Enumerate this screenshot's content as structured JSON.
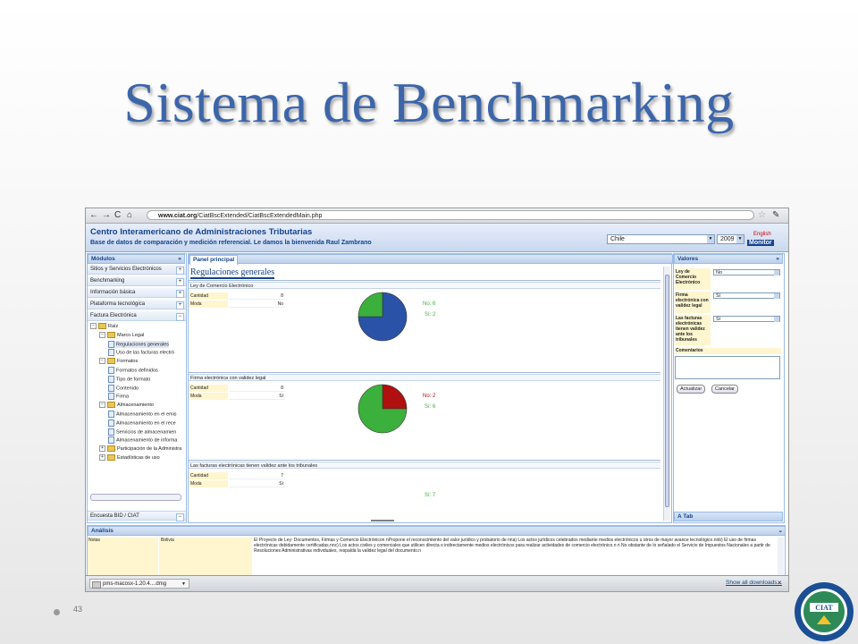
{
  "slide": {
    "title": "Sistema de Benchmarking",
    "page_number": "43",
    "seal_text": "CIAT"
  },
  "browser": {
    "url_host": "www.ciat.org",
    "url_path": "/CiatBscExtended/CiatBscExtendedMain.php",
    "back": "←",
    "forward": "→",
    "reload": "C",
    "home": "⌂"
  },
  "app": {
    "org_name": "Centro Interamericano de Administraciones Tributarias",
    "welcome": "Base de datos de comparación y medición referencial. Le damos la bienvenida Raul Zambrano",
    "country": "Chile",
    "year": "2009",
    "language": "English",
    "monitor": "Monitor"
  },
  "modules": {
    "header": "Módulos",
    "items": [
      {
        "label": "Sitios y Servicios Electrónicos",
        "toggle": "+"
      },
      {
        "label": "Benchmarking",
        "toggle": "+"
      },
      {
        "label": "Información básica",
        "toggle": "+"
      },
      {
        "label": "Plataforma tecnológica",
        "toggle": "+"
      },
      {
        "label": "Factura Electrónica",
        "toggle": "−"
      }
    ],
    "tree": [
      {
        "label": "Raíz",
        "type": "folder",
        "level": 0
      },
      {
        "label": "Marco Legal",
        "type": "folder",
        "level": 1
      },
      {
        "label": "Regulaciones generales",
        "type": "doc",
        "level": 2,
        "selected": true
      },
      {
        "label": "Uso de las facturas electró",
        "type": "doc",
        "level": 2
      },
      {
        "label": "Formatos",
        "type": "folder",
        "level": 1
      },
      {
        "label": "Formatos definidos",
        "type": "doc",
        "level": 2
      },
      {
        "label": "Tipo de formato",
        "type": "doc",
        "level": 2
      },
      {
        "label": "Contenido",
        "type": "doc",
        "level": 2
      },
      {
        "label": "Firma",
        "type": "doc",
        "level": 2
      },
      {
        "label": "Almacenamiento",
        "type": "folder",
        "level": 1
      },
      {
        "label": "Almacenamiento en el emis",
        "type": "doc",
        "level": 2
      },
      {
        "label": "Almacenamiento en el rece",
        "type": "doc",
        "level": 2
      },
      {
        "label": "Servicios de almacenamien",
        "type": "doc",
        "level": 2
      },
      {
        "label": "Almacenamiento de informa",
        "type": "doc",
        "level": 2
      },
      {
        "label": "Participación de la Administra",
        "type": "folder",
        "level": 1
      },
      {
        "label": "Estadísticas de uso",
        "type": "folder",
        "level": 1
      }
    ],
    "footer": "Encuesta BID / CIAT"
  },
  "main": {
    "tab": "Panel principal",
    "section_title": "Regulaciones generales",
    "cantidad_label": "Cantidad",
    "moda_label": "Moda",
    "blocks": [
      {
        "title": "Ley de Comercio Electrónico",
        "cantidad": "8",
        "moda": "No",
        "no_label": "No: 6",
        "si_label": "Sí: 2",
        "no": 6,
        "si": 2
      },
      {
        "title": "Firma electrónica con validez legal",
        "cantidad": "8",
        "moda": "Sí",
        "no_label": "No: 2",
        "si_label": "Sí: 6",
        "no": 2,
        "si": 6
      },
      {
        "title": "Las facturas electrónicas tienen validez ante los tribunales",
        "cantidad": "7",
        "moda": "Sí",
        "no_label": "",
        "si_label": "Sí: 7",
        "no": 0,
        "si": 7
      }
    ]
  },
  "values_panel": {
    "header": "Valores",
    "rows": [
      {
        "label": "Ley de Comercio Electrónico",
        "value": "No"
      },
      {
        "label": "Firma electrónica con validez legal",
        "value": "Sí"
      },
      {
        "label": "Las facturas electrónicas tienen validez ante los tribunales",
        "value": "Sí"
      }
    ],
    "comments_label": "Comentarios",
    "update_button": "Actualizar",
    "cancel_button": "Cancelar",
    "tab": "A Tab"
  },
  "analysis": {
    "header": "Análisis",
    "notes_label": "Notas",
    "country": "Bolivia",
    "text": "El Proyecto de Ley: Documentos, Firmas y Comercio Electrónicon nPropone el reconocimiento del valor jurídico y probatorio de nna) Los actos jurídicos celebrados mediante medios electrónicos u otros de mayor avance tecnológico.nnb) El uso de firmas electrónicas debidamente certificadas.nnc) Los actos civiles y comerciales que utilicen directa o indirectamente medios electrónicos para realizar actividades de comercio electrónico.n n No obstante de lo señalado el Servicio de Impuestos Nacionales a partir de Resoluciones Administrativas individuales, respalda la validez legal del documento.n"
  },
  "statusbar": {
    "download": "pms-macosx-1.20.4....dmg",
    "show_all": "Show all downloads..."
  },
  "colors": {
    "no": "#2a53a8",
    "si": "#3cb03c",
    "accent": "#15428b",
    "title": "#3d66a9"
  }
}
